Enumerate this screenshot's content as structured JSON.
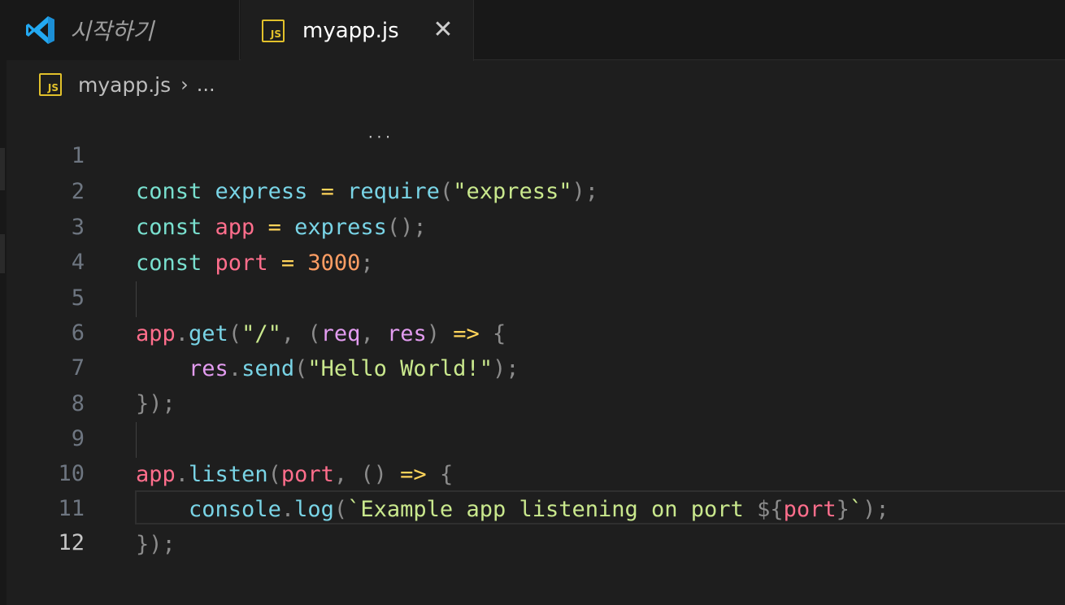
{
  "tabs": [
    {
      "label": "시작하기",
      "icon": "vscode-logo-icon",
      "active": false
    },
    {
      "label": "myapp.js",
      "icon": "js-file-icon",
      "icon_text": "JS",
      "active": true,
      "close_glyph": "✕"
    }
  ],
  "breadcrumb": {
    "file": "myapp.js",
    "separator": "›",
    "more": "..."
  },
  "editor": {
    "active_line": 12,
    "line_numbers": [
      "1",
      "2",
      "3",
      "4",
      "5",
      "6",
      "7",
      "8",
      "9",
      "10",
      "11",
      "12"
    ]
  },
  "code_tokens": {
    "l1": [
      "const",
      " ",
      "express",
      " ",
      "=",
      " ",
      "require",
      "(",
      "\"express\"",
      ");"
    ],
    "l2": [
      "const",
      " ",
      "app",
      " ",
      "=",
      " ",
      "express",
      "();"
    ],
    "l3": [
      "const",
      " ",
      "port",
      " ",
      "=",
      " ",
      "3000",
      ";"
    ],
    "l5": [
      "app",
      ".",
      "get",
      "(",
      "\"/\"",
      ", (",
      "req",
      ", ",
      "res",
      ") ",
      "=>",
      " {"
    ],
    "l6": [
      "    ",
      "res",
      ".",
      "send",
      "(",
      "\"Hello World!\"",
      ");"
    ],
    "l7": [
      "});"
    ],
    "l9": [
      "app",
      ".",
      "listen",
      "(",
      "port",
      ", () ",
      "=>",
      " {"
    ],
    "l10": [
      "    ",
      "console",
      ".",
      "log",
      "(",
      "`Example app listening on port ",
      "${",
      "port",
      "}",
      "`",
      ");"
    ],
    "l11": [
      "});"
    ]
  },
  "colors": {
    "background": "#1e1e1e",
    "keyword": "#79e0cf",
    "function": "#79d4e6",
    "variable": "#ff6e8c",
    "parameter": "#e39cf0",
    "operator": "#ffd45a",
    "string": "#c9e88d",
    "number": "#ff9e64",
    "js_badge": "#e2c12b",
    "vscode_blue": "#23a9f2"
  }
}
